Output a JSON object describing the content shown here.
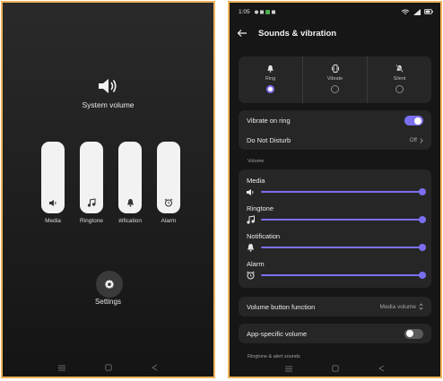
{
  "colors": {
    "accent": "#7b6ff0",
    "frame_border": "#f1b25a"
  },
  "volume_panel": {
    "title": "System volume",
    "sliders": [
      {
        "label": "Media",
        "icon": "speaker-icon"
      },
      {
        "label": "Ringtone",
        "icon": "music-note-icon"
      },
      {
        "label": "Notification",
        "icon": "bell-icon"
      },
      {
        "label": "Alarm",
        "icon": "alarm-clock-icon"
      }
    ],
    "settings_label": "Settings"
  },
  "status_bar": {
    "time": "1:05",
    "battery": ""
  },
  "settings_page": {
    "title": "Sounds & vibration",
    "modes": [
      {
        "label": "Ring",
        "selected": true
      },
      {
        "label": "Vibrate",
        "selected": false
      },
      {
        "label": "Silent",
        "selected": false
      }
    ],
    "vibrate_on_ring": {
      "label": "Vibrate on ring",
      "enabled": true
    },
    "do_not_disturb": {
      "label": "Do Not Disturb",
      "value": "Off"
    },
    "volume_section_label": "Volume",
    "volume_items": [
      {
        "label": "Media",
        "icon": "speaker-icon",
        "level": 1.0
      },
      {
        "label": "Ringtone",
        "icon": "music-note-icon",
        "level": 1.0
      },
      {
        "label": "Notification",
        "icon": "bell-icon",
        "level": 1.0
      },
      {
        "label": "Alarm",
        "icon": "alarm-clock-icon",
        "level": 1.0
      }
    ],
    "volume_button_function": {
      "label": "Volume button function",
      "value": "Media volume"
    },
    "app_specific_volume": {
      "label": "App-specific volume",
      "enabled": false
    },
    "bottom_section_label": "Ringtone & alert sounds"
  }
}
